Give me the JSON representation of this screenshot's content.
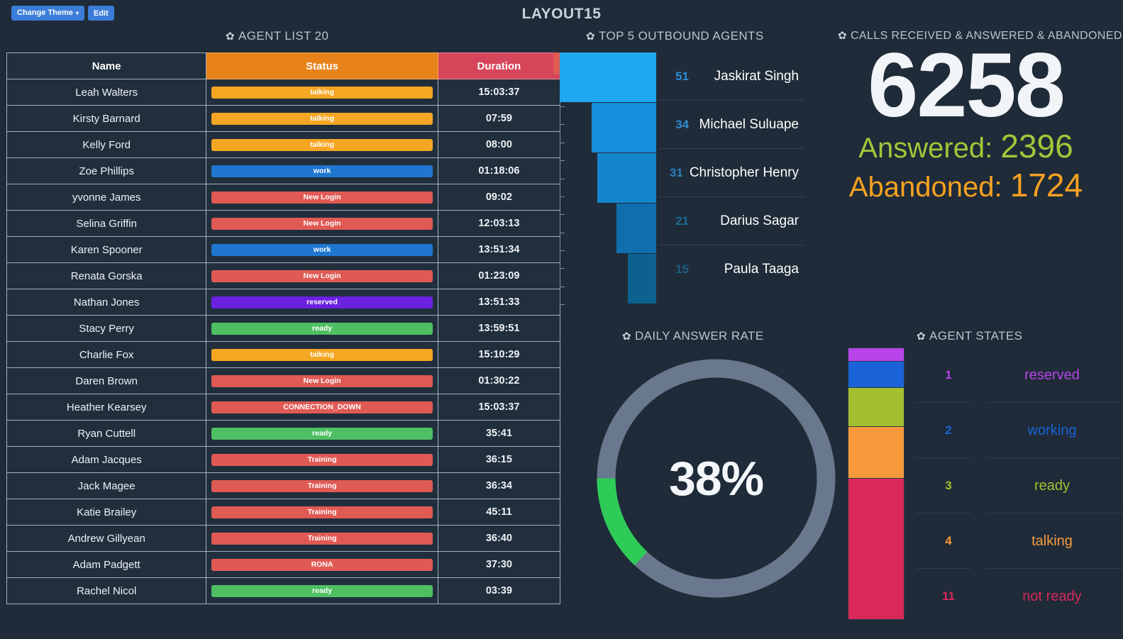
{
  "topbar": {
    "change_theme_label": "Change Theme",
    "caret": "▾",
    "edit_label": "Edit",
    "page_title": "LAYOUT15"
  },
  "agent_list": {
    "heading": "AGENT LIST 20",
    "gear": "✿",
    "columns": [
      "Name",
      "Status",
      "Duration"
    ],
    "rows": [
      {
        "name": "Leah Walters",
        "status": "talking",
        "status_key": "talking",
        "duration": "15:03:37"
      },
      {
        "name": "Kirsty Barnard",
        "status": "talking",
        "status_key": "talking",
        "duration": "07:59"
      },
      {
        "name": "Kelly Ford",
        "status": "talking",
        "status_key": "talking",
        "duration": "08:00"
      },
      {
        "name": "Zoe Phillips",
        "status": "work",
        "status_key": "work",
        "duration": "01:18:06"
      },
      {
        "name": "yvonne James",
        "status": "New Login",
        "status_key": "newlogin",
        "duration": "09:02"
      },
      {
        "name": "Selina Griffin",
        "status": "New Login",
        "status_key": "newlogin",
        "duration": "12:03:13"
      },
      {
        "name": "Karen Spooner",
        "status": "work",
        "status_key": "work",
        "duration": "13:51:34"
      },
      {
        "name": "Renata Gorska",
        "status": "New Login",
        "status_key": "newlogin",
        "duration": "01:23:09"
      },
      {
        "name": "Nathan Jones",
        "status": "reserved",
        "status_key": "reserved",
        "duration": "13:51:33"
      },
      {
        "name": "Stacy Perry",
        "status": "ready",
        "status_key": "ready",
        "duration": "13:59:51"
      },
      {
        "name": "Charlie Fox",
        "status": "talking",
        "status_key": "talking",
        "duration": "15:10:29"
      },
      {
        "name": "Daren Brown",
        "status": "New Login",
        "status_key": "newlogin",
        "duration": "01:30:22"
      },
      {
        "name": "Heather Kearsey",
        "status": "CONNECTION_DOWN",
        "status_key": "conn",
        "duration": "15:03:37"
      },
      {
        "name": "Ryan Cuttell",
        "status": "ready",
        "status_key": "ready",
        "duration": "35:41"
      },
      {
        "name": "Adam Jacques",
        "status": "Training",
        "status_key": "training",
        "duration": "36:15"
      },
      {
        "name": "Jack Magee",
        "status": "Training",
        "status_key": "training",
        "duration": "36:34"
      },
      {
        "name": "Katie Brailey",
        "status": "Training",
        "status_key": "training",
        "duration": "45:11"
      },
      {
        "name": "Andrew Gillyean",
        "status": "Training",
        "status_key": "training",
        "duration": "36:40"
      },
      {
        "name": "Adam Padgett",
        "status": "RONA",
        "status_key": "rona",
        "duration": "37:30"
      },
      {
        "name": "Rachel Nicol",
        "status": "ready",
        "status_key": "ready",
        "duration": "03:39"
      }
    ]
  },
  "top5": {
    "heading": "TOP 5 OUTBOUND AGENTS",
    "gear": "✿",
    "chart_data": {
      "type": "bar",
      "title": "TOP 5 OUTBOUND AGENTS",
      "orientation": "horizontal-right-aligned",
      "categories": [
        "Jaskirat Singh",
        "Michael Suluape",
        "Christopher Henry",
        "Darius Sagar",
        "Paula Taaga"
      ],
      "values": [
        51,
        34,
        31,
        21,
        15
      ],
      "colors": [
        "#1fa8ef",
        "#1690dd",
        "#1484cc",
        "#0f6fae",
        "#0d618f"
      ],
      "value_colors": [
        "#2e8fd6",
        "#2f8ed2",
        "#2a7fba",
        "#1f6a96",
        "#1d5e83"
      ],
      "xlabel": "",
      "ylabel": "",
      "grid": false,
      "legend": "none"
    }
  },
  "calls": {
    "heading": "CALLS RECEIVED & ANSWERED & ABANDONED",
    "gear": "✿",
    "total": "6258",
    "answered_label": "Answered:",
    "answered_value": "2396",
    "abandoned_label": "Abandoned:",
    "abandoned_value": "1724",
    "total_color": "#f2f5f8",
    "answered_color": "#9ec93a",
    "abandoned_color": "#f6a121"
  },
  "answer_rate": {
    "heading": "DAILY ANSWER RATE",
    "gear": "✿",
    "chart_data": {
      "type": "pie",
      "subtype": "donut-gauge",
      "title": "DAILY ANSWER RATE",
      "center_label": "38%",
      "categories": [
        "answered",
        "remaining"
      ],
      "values": [
        38,
        62
      ],
      "colors": [
        "#2ecc57",
        "#69788c"
      ],
      "direction": "counter-clockwise",
      "start_angle_deg": 0,
      "legend": "none"
    }
  },
  "agent_states": {
    "heading": "AGENT STATES",
    "gear": "✿",
    "chart_data": {
      "type": "bar",
      "subtype": "stacked-vertical",
      "title": "AGENT STATES",
      "categories": [
        "reserved",
        "working",
        "ready",
        "talking",
        "not ready"
      ],
      "values": [
        1,
        2,
        3,
        4,
        11
      ],
      "colors": [
        "#b744e8",
        "#1a62d8",
        "#a2c030",
        "#f89a3c",
        "#d8295a"
      ],
      "total": 21,
      "legend": "right",
      "grid": false
    },
    "rows": [
      {
        "count": "1",
        "label": "reserved",
        "color": "#b744e8"
      },
      {
        "count": "2",
        "label": "working",
        "color": "#1a62d8"
      },
      {
        "count": "3",
        "label": "ready",
        "color": "#a2c030"
      },
      {
        "count": "4",
        "label": "talking",
        "color": "#f89a3c"
      },
      {
        "count": "11",
        "label": "not ready",
        "color": "#d8295a"
      }
    ]
  }
}
